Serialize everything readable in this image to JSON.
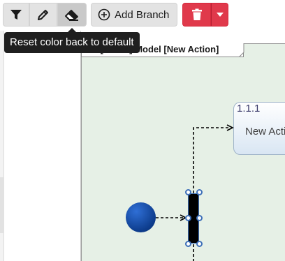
{
  "toolbar": {
    "filter_icon": "filter-icon",
    "edit_icon": "pencil-icon",
    "eraser_icon": "eraser-icon",
    "add_branch_label": "Add Branch",
    "delete_icon": "trash-icon",
    "delete_menu_icon": "caret-down-icon"
  },
  "tooltip": {
    "text": "Reset color back to default"
  },
  "diagram": {
    "frame_title": "act [Model] Model [New Action]",
    "action": {
      "id": "1.1.1",
      "name": "New Action"
    }
  },
  "colors": {
    "canvas_bg": "#e6f0e6",
    "delete_red": "#e0394b",
    "selection_blue": "#3d6fb8",
    "start_node_blue": "#0d3c8c"
  }
}
